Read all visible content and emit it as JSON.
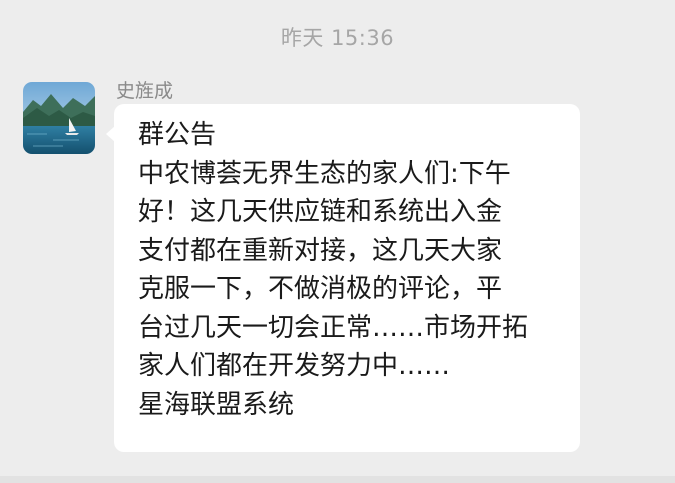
{
  "timestamp": "昨天 15:36",
  "message": {
    "sender_name": "史旌成",
    "avatar_icon": "lake-boat-landscape-avatar",
    "lines": [
      "群公告",
      "中农博荟无界生态的家人们:下午",
      "好！这几天供应链和系统出入金",
      "支付都在重新对接，这几天大家",
      "克服一下，不做消极的评论，平",
      "台过几天一切会正常……市场开拓",
      "家人们都在开发努力中……",
      "星海联盟系统"
    ]
  },
  "colors": {
    "background": "#ededed",
    "bubble": "#ffffff",
    "timestamp_text": "#a6a6a6",
    "sender_text": "#8a8a8a",
    "message_text": "#1a1a1a"
  }
}
